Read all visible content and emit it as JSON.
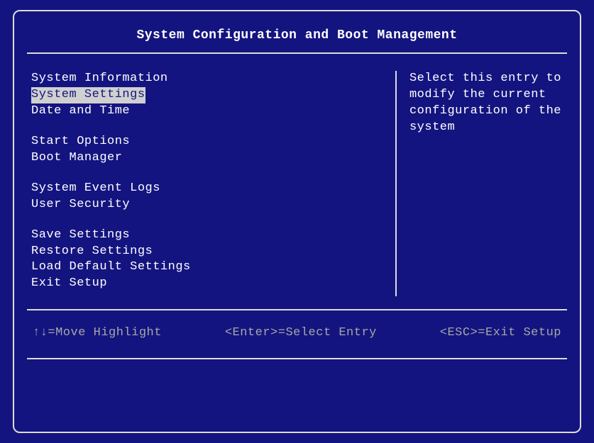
{
  "title": "System Configuration and Boot Management",
  "menu": {
    "groups": [
      {
        "items": [
          {
            "label": "System Information",
            "selected": false
          },
          {
            "label": "System Settings",
            "selected": true
          },
          {
            "label": "Date and Time",
            "selected": false
          }
        ]
      },
      {
        "items": [
          {
            "label": "Start Options",
            "selected": false
          },
          {
            "label": "Boot Manager",
            "selected": false
          }
        ]
      },
      {
        "items": [
          {
            "label": "System Event Logs",
            "selected": false
          },
          {
            "label": "User Security",
            "selected": false
          }
        ]
      },
      {
        "items": [
          {
            "label": "Save Settings",
            "selected": false
          },
          {
            "label": "Restore Settings",
            "selected": false
          },
          {
            "label": "Load Default Settings",
            "selected": false
          },
          {
            "label": "Exit Setup",
            "selected": false
          }
        ]
      }
    ]
  },
  "help_text": "Select this entry to modify the current configuration of the system",
  "hints": {
    "move": "↑↓=Move Highlight",
    "enter": "<Enter>=Select Entry",
    "esc": "<ESC>=Exit Setup"
  }
}
